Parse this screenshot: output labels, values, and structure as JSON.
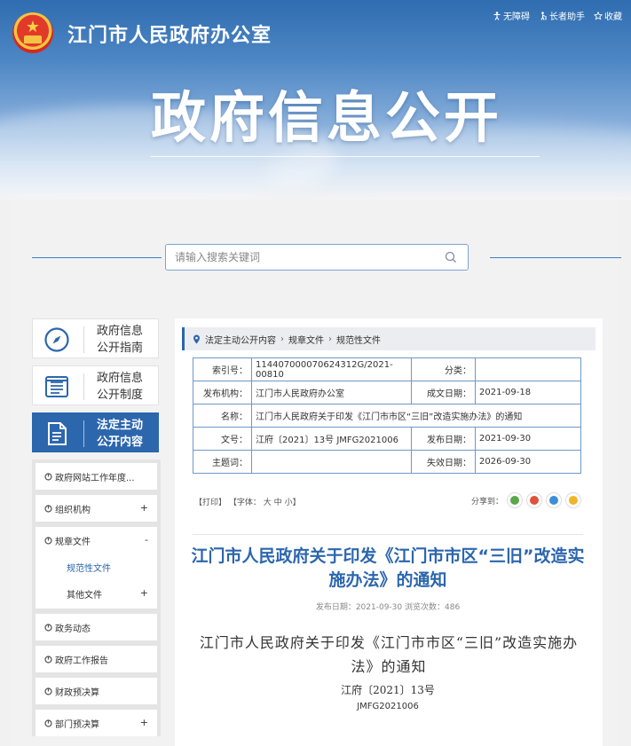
{
  "header": {
    "site_title": "江门市人民政府办公室",
    "hero_title": "政府信息公开",
    "top_links": [
      {
        "label": "无障碍",
        "icon": "accessibility-icon"
      },
      {
        "label": "长者助手",
        "icon": "elder-icon"
      },
      {
        "label": "收藏",
        "icon": "star-icon"
      }
    ]
  },
  "search": {
    "placeholder": "请输入搜索关键词"
  },
  "sidebar": {
    "cards": [
      {
        "label_line1": "政府信息",
        "label_line2": "公开指南",
        "icon": "compass-icon"
      },
      {
        "label_line1": "政府信息",
        "label_line2": "公开制度",
        "icon": "list-icon"
      },
      {
        "label_line1": "法定主动",
        "label_line2": "公开内容",
        "icon": "document-icon",
        "active": true
      }
    ],
    "items": [
      {
        "label": "政府网站工作年度...",
        "toggle": ""
      },
      {
        "label": "组织机构",
        "toggle": "+"
      },
      {
        "label": "规章文件",
        "toggle": "-",
        "children": [
          {
            "label": "规范性文件",
            "current": true,
            "toggle": ""
          },
          {
            "label": "其他文件",
            "toggle": "+"
          }
        ]
      },
      {
        "label": "政务动态",
        "toggle": ""
      },
      {
        "label": "政府工作报告",
        "toggle": ""
      },
      {
        "label": "财政预决算",
        "toggle": ""
      },
      {
        "label": "部门预决算",
        "toggle": "+"
      }
    ]
  },
  "breadcrumb": [
    "法定主动公开内容",
    "规章文件",
    "规范性文件"
  ],
  "meta": {
    "index_no_label": "索引号：",
    "index_no": "114407000070624312G/2021-00810",
    "category_label": "分类：",
    "category": "",
    "publisher_label": "发布机构：",
    "publisher": "江门市人民政府办公室",
    "created_label": "成文日期：",
    "created": "2021-09-18",
    "name_label": "名称：",
    "name": "江门市人民政府关于印发《江门市市区“三旧”改造实施办法》的通知",
    "doc_no_label": "文号：",
    "doc_no": "江府〔2021〕13号 JMFG2021006",
    "publish_label": "发布日期：",
    "publish": "2021-09-30",
    "subject_label": "主题词：",
    "subject": "",
    "expire_label": "失效日期：",
    "expire": "2026-09-30"
  },
  "tools": {
    "print": "【打印】",
    "font_label": "【字体：",
    "font_big": "大",
    "font_mid": "中",
    "font_small": "小",
    "font_end": "】",
    "share_label": "分享到："
  },
  "share_icons": [
    {
      "name": "wechat-icon",
      "color": "#5aa84a"
    },
    {
      "name": "weibo-icon",
      "color": "#e0523f"
    },
    {
      "name": "qq-icon",
      "color": "#3b8fd6"
    },
    {
      "name": "qzone-icon",
      "color": "#f0b428"
    }
  ],
  "document": {
    "title": "江门市人民政府关于印发《江门市市区“三旧”改造实施办法》的通知",
    "publish_meta": "发布日期：2021-09-30  浏览次数：486",
    "body_title": "江门市人民政府关于印发《江门市市区“三旧”改造实施办法》的通知",
    "doc_no": "江府〔2021〕13号",
    "code": "JMFG2021006"
  }
}
